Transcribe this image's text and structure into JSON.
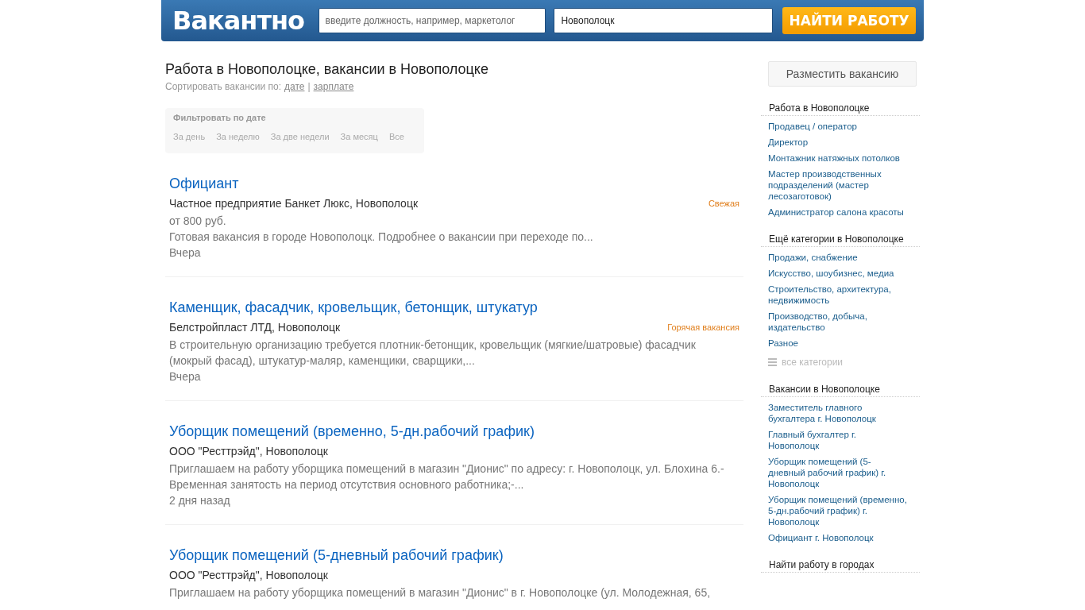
{
  "header": {
    "logo": "Вакантно",
    "query": {
      "placeholder": "введите должность, например, маркетолог"
    },
    "city": {
      "value": "Новополоцк"
    },
    "search_button": "НАЙТИ РАБОТУ"
  },
  "page_title": "Работа в Новополоцке, вакансии в Новополоцке",
  "sort": {
    "label": "Сортировать вакансии по:",
    "options": [
      "дате",
      "зарплате"
    ],
    "separator": "|"
  },
  "date_filter": {
    "title": "Фильтровать по дате",
    "options": [
      "За день",
      "За неделю",
      "За две недели",
      "За месяц",
      "Все"
    ]
  },
  "jobs": [
    {
      "title": "Официант",
      "company": "Частное предприятие Банкет Люкс, Новополоцк",
      "tag": "Свежая",
      "salary": "от 800 руб.",
      "description": "Готовая вакансия в городе Новополоцк. Подробнее о вакансии при переходе по...",
      "date": "Вчера"
    },
    {
      "title": "Каменщик, фасадчик, кровельщик, бетонщик, штукатур",
      "company": "Белстройпласт ЛТД, Новополоцк",
      "tag": "Горячая вакансия",
      "description": "В строительную организацию требуется плотник-бетонщик, кровельщик (мягкие/шатровые) фасадчик (мокрый фасад), штукатур-маляр, каменщики, сварщики,...",
      "date": "Вчера"
    },
    {
      "title": "Уборщик помещений (временно, 5-дн.рабочий график)",
      "company": "ООО \"Ресттрэйд\", Новополоцк",
      "description": "Приглашаем на работу уборщика помещений в магазин \"Дионис\" по адресу: г. Новополоцк, ул. Блохина 6.-Временная занятость на период отсутствия основного работника;-...",
      "date": "2 дня назад"
    },
    {
      "title": "Уборщик помещений (5-дневный рабочий график)",
      "company": "ООО \"Ресттрэйд\", Новополоцк",
      "description": "Приглашаем на работу уборщика помещений в магазин \"Дионис\" в г. Новополоцке (ул. Молодежная, 65,"
    }
  ],
  "sidebar": {
    "post_button": "Разместить вакансию",
    "sections": [
      {
        "title": "Работа в Новополоцке",
        "links": [
          "Продавец / оператор",
          "Директор",
          "Монтажник натяжных потолков",
          "Мастер производственных подразделений (мастер лесозаготовок)",
          "Администратор салона красоты"
        ]
      },
      {
        "title": "Ещё категории в Новополоцке",
        "links": [
          "Продажи, снабжение",
          "Искусство, шоубизнес, медиа",
          "Строительство, архитектура, недвижимость",
          "Производство, добыча, издательство",
          "Разное"
        ],
        "more": "все категории"
      },
      {
        "title": "Вакансии в Новополоцке",
        "links": [
          "Заместитель главного бухгалтера г. Новополоцк",
          "Главный бухгалтер г. Новополоцк",
          "Уборщик помещений (5-дневный рабочий график) г. Новополоцк",
          "Уборщик помещений (временно, 5-дн.рабочий график) г. Новополоцк",
          "Официант г. Новополоцк"
        ]
      },
      {
        "title": "Найти работу в городах"
      }
    ]
  }
}
